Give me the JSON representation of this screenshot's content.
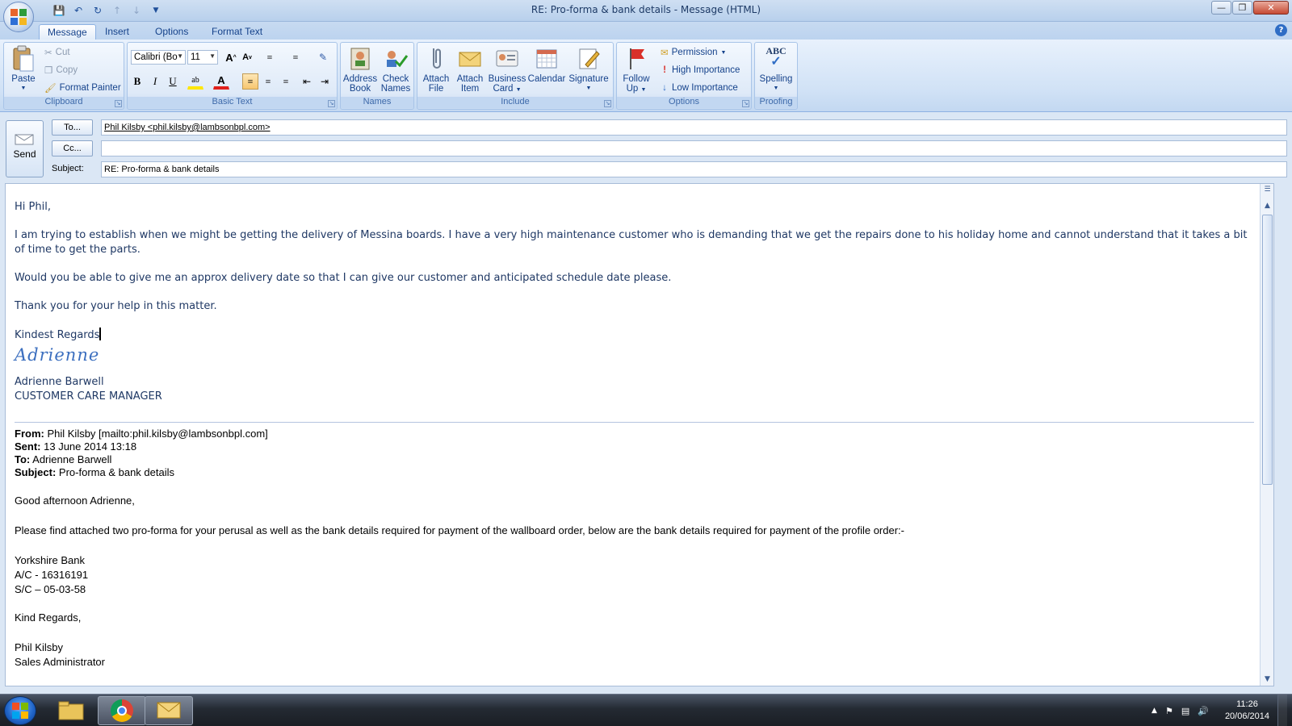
{
  "window": {
    "title": "RE: Pro-forma & bank details - Message (HTML)"
  },
  "tabs": [
    {
      "label": "Message"
    },
    {
      "label": "Insert"
    },
    {
      "label": "Options"
    },
    {
      "label": "Format Text"
    }
  ],
  "ribbon": {
    "clipboard": {
      "label": "Clipboard",
      "paste": "Paste",
      "cut": "Cut",
      "copy": "Copy",
      "format_painter": "Format Painter"
    },
    "basic_text": {
      "label": "Basic Text",
      "font": "Calibri (Bo",
      "size": "11",
      "bold": "B",
      "italic": "I",
      "underline": "U"
    },
    "names": {
      "label": "Names",
      "address_book": [
        "Address",
        "Book"
      ],
      "check_names": [
        "Check",
        "Names"
      ]
    },
    "include": {
      "label": "Include",
      "attach_file": [
        "Attach",
        "File"
      ],
      "attach_item": [
        "Attach",
        "Item"
      ],
      "business_card": [
        "Business",
        "Card"
      ],
      "calendar": "Calendar",
      "signature": "Signature"
    },
    "options": {
      "label": "Options",
      "follow_up": [
        "Follow",
        "Up"
      ],
      "permission": "Permission",
      "high_importance": "High Importance",
      "low_importance": "Low Importance"
    },
    "proofing": {
      "label": "Proofing",
      "spelling": "Spelling",
      "abc": "ABC"
    }
  },
  "header": {
    "send": "Send",
    "to_button": "To...",
    "cc_button": "Cc...",
    "subject_label": "Subject:",
    "to_value": "Phil Kilsby <phil.kilsby@lambsonbpl.com>",
    "cc_value": "",
    "subject_value": "RE: Pro-forma & bank details"
  },
  "message": {
    "greeting": "Hi Phil,",
    "para1": "I am trying to establish when we might be getting the delivery of Messina boards.  I have a very high maintenance customer who is demanding that we get the repairs done to his holiday home and cannot understand that it takes a bit of time to get the parts.",
    "para2": "Would you be able to give me an approx delivery date so that I can give our customer and anticipated schedule date please.",
    "para3": "Thank you for your help in this matter.",
    "closing": "Kindest Regards",
    "signature_script": "Adrienne",
    "sig_name": "Adrienne Barwell",
    "sig_title": "CUSTOMER CARE MANAGER"
  },
  "quoted": {
    "from_label": "From:",
    "from_value": "Phil Kilsby [mailto:phil.kilsby@lambsonbpl.com]",
    "sent_label": "Sent:",
    "sent_value": "13 June 2014 13:18",
    "to_label": "To:",
    "to_value": "Adrienne Barwell",
    "subject_label": "Subject:",
    "subject_value": "Pro-forma & bank details",
    "greeting": "Good afternoon Adrienne,",
    "para1": "Please find attached two pro-forma for your perusal as well as the bank details required for payment of the wallboard order, below are the bank details required for payment of the profile order:-",
    "bank": "Yorkshire Bank",
    "ac": "A/C - 16316191",
    "sc": "S/C – 05-03-58",
    "closing": "Kind Regards,",
    "name": "Phil Kilsby",
    "title_partial": "Sales Administrator"
  },
  "taskbar": {
    "time": "11:26",
    "date": "20/06/2014"
  }
}
